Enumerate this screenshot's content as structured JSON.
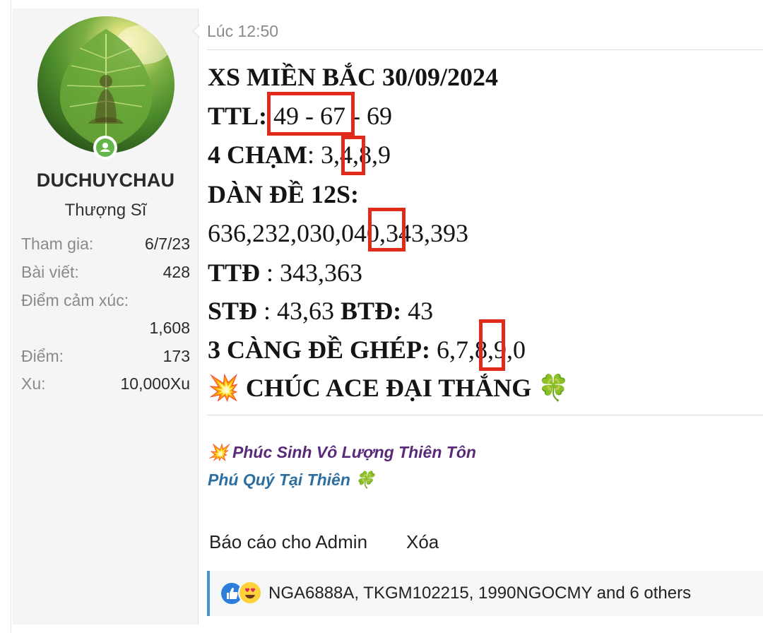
{
  "user": {
    "username": "DUCHUYCHAU",
    "rank": "Thượng Sĩ",
    "stats": [
      {
        "label": "Tham gia:",
        "value": "6/7/23"
      },
      {
        "label": "Bài viết:",
        "value": "428"
      },
      {
        "label": "Điểm cảm xúc:",
        "value": "1,608"
      },
      {
        "label": "Điểm:",
        "value": "173"
      },
      {
        "label": "Xu:",
        "value": "10,000Xu"
      }
    ]
  },
  "post": {
    "timestamp": "Lúc 12:50",
    "lines": {
      "title": "XS MIỀN BẮC 30/09/2024",
      "ttl_label": "TTL:",
      "ttl_value": " 49 - 67 - 69",
      "cham_label": "4 CHẠM",
      "cham_value": ": 3,4,8,9",
      "dan_de_label": "DÀN ĐỀ 12S:",
      "dan_de_value": "636,232,030,040,343,393",
      "ttd_label": "TTĐ",
      "ttd_value": " : 343,363",
      "std_label": "STĐ",
      "std_value": " : 43,63 ",
      "btd_label": "BTĐ:",
      "btd_value": " 43",
      "cang_label": "3 CÀNG ĐỀ GHÉP:",
      "cang_value": " 6,7,8,9,0",
      "wish": "CHÚC ACE ĐẠI THẮNG",
      "wish_emoji_left": "💥",
      "wish_emoji_right": "🍀"
    },
    "signature": {
      "line1": "Phúc Sinh Vô Lượng Thiên Tôn",
      "line1_emoji": "💥",
      "line2": "Phú Quý Tại Thiên",
      "line2_emoji": "🍀"
    },
    "actions": {
      "report": "Báo cáo cho Admin",
      "delete": "Xóa"
    },
    "reactions": {
      "text": "NGA6888A, TKGM102215, 1990NGOCMY and 6 others",
      "icons": [
        "like-icon",
        "love-eyes-icon"
      ]
    }
  },
  "colors": {
    "highlight_box": "#e02a1a",
    "signature_purple": "#5a2a7a",
    "signature_blue": "#2e6e9e",
    "reaction_bar_accent": "#4a90d0",
    "online_indicator": "#63b64a"
  }
}
